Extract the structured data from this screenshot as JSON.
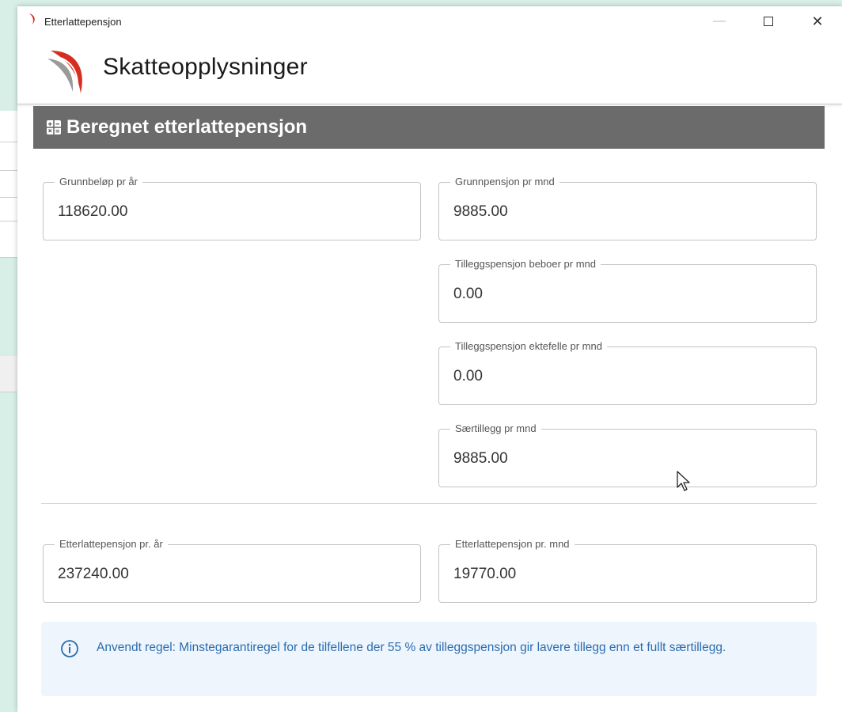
{
  "window": {
    "title": "Etterlattepensjon",
    "controls": {
      "minimize": "—",
      "close": "✕"
    }
  },
  "header": {
    "title": "Skatteopplysninger"
  },
  "section": {
    "title": "Beregnet etterlattepensjon",
    "icon": "calculator-icon"
  },
  "fields": {
    "grunnbelop": {
      "label": "Grunnbeløp pr år",
      "value": "118620.00"
    },
    "grunnpensjon": {
      "label": "Grunnpensjon pr mnd",
      "value": "9885.00"
    },
    "tillegg_beboer": {
      "label": "Tilleggspensjon beboer pr mnd",
      "value": "0.00"
    },
    "tillegg_ektefelle": {
      "label": "Tilleggspensjon ektefelle pr mnd",
      "value": "0.00"
    },
    "saertillegg": {
      "label": "Særtillegg pr mnd",
      "value": "9885.00"
    },
    "etterlatte_ar": {
      "label": "Etterlattepensjon pr. år",
      "value": "237240.00"
    },
    "etterlatte_mnd": {
      "label": "Etterlattepensjon pr. mnd",
      "value": "19770.00"
    }
  },
  "info": {
    "icon": "info-icon",
    "text": "Anvendt regel: Minstegarantiregel for de tilfellene der 55 % av tilleggspensjon gir lavere tillegg enn et fullt særtillegg."
  },
  "colors": {
    "section_bar": "#6b6b6b",
    "info_bg": "#eef5fc",
    "info_text": "#2b6cb0",
    "logo_red": "#d62d20",
    "logo_grey": "#8c8c8c"
  }
}
